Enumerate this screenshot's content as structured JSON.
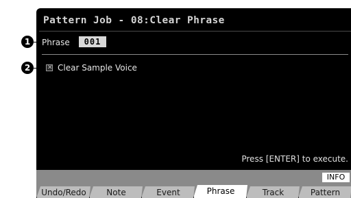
{
  "header": {
    "title": "Pattern Job - 08:Clear Phrase"
  },
  "phrase": {
    "label": "Phrase",
    "value": "001"
  },
  "clear_sample_voice": {
    "label": "Clear Sample Voice",
    "checked": true
  },
  "status": {
    "message": "Press [ENTER] to execute."
  },
  "info_button": {
    "label": "INFO"
  },
  "tabs": [
    {
      "label": "Undo/Redo",
      "active": false
    },
    {
      "label": "Note",
      "active": false
    },
    {
      "label": "Event",
      "active": false
    },
    {
      "label": "Phrase",
      "active": true
    },
    {
      "label": "Track",
      "active": false
    },
    {
      "label": "Pattern",
      "active": false
    }
  ],
  "callouts": [
    {
      "number": "1",
      "target": "phrase"
    },
    {
      "number": "2",
      "target": "clear-sample-voice"
    }
  ]
}
